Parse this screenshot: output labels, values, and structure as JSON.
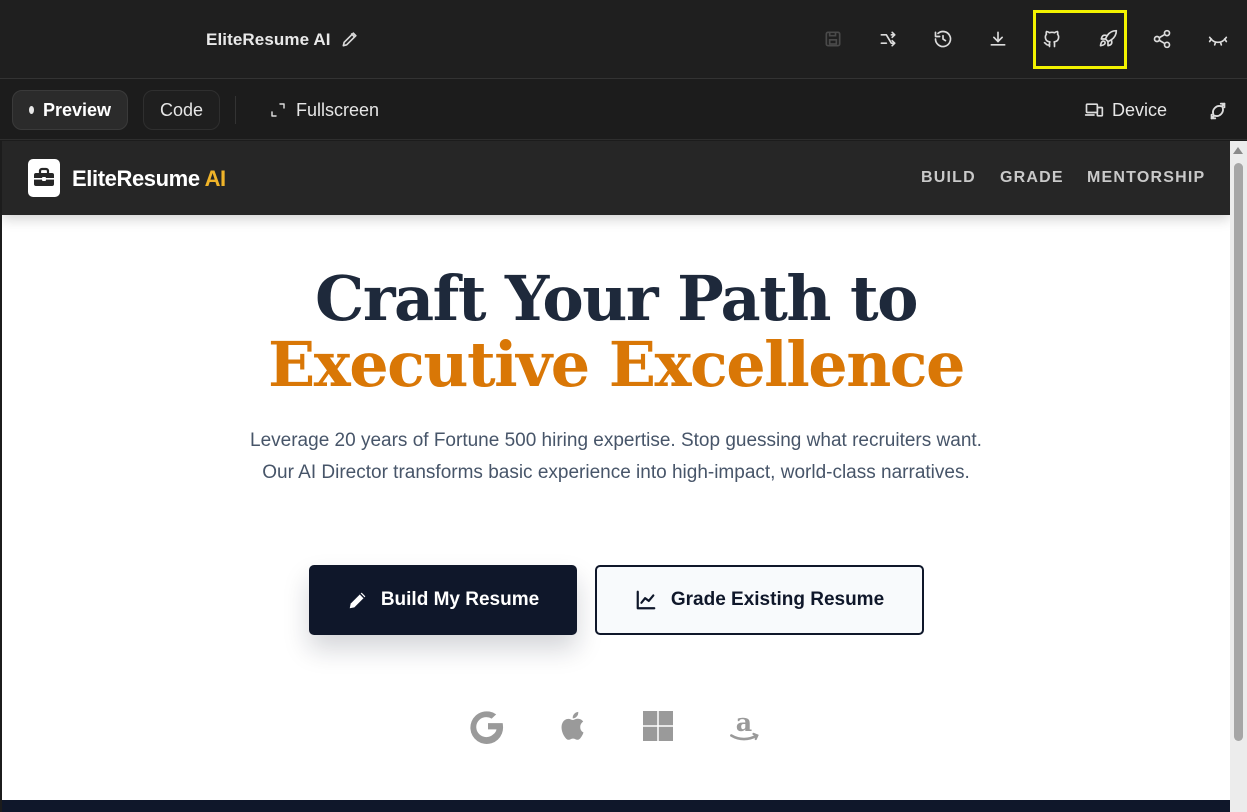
{
  "app": {
    "title": "EliteResume AI"
  },
  "toolbar": {
    "icons": [
      "save-icon",
      "branch-icon",
      "history-icon",
      "download-icon",
      "github-icon",
      "rocket-icon",
      "share-icon",
      "eye-off-icon"
    ],
    "highlight_color": "#f2f200"
  },
  "view_toolbar": {
    "preview_label": "Preview",
    "code_label": "Code",
    "fullscreen_label": "Fullscreen",
    "device_label": "Device"
  },
  "site": {
    "brand_main": "EliteResume",
    "brand_accent": "AI",
    "nav": [
      "BUILD",
      "GRADE",
      "MENTORSHIP"
    ],
    "hero_line1": "Craft Your Path to",
    "hero_line2": "Executive Excellence",
    "hero_sub": "Leverage 20 years of Fortune 500 hiring expertise. Stop guessing what recruiters want. Our AI Director transforms basic experience into high-impact, world-class narratives.",
    "cta_primary": "Build My Resume",
    "cta_secondary": "Grade Existing Resume",
    "company_logos": [
      "google-logo",
      "apple-logo",
      "windows-logo",
      "amazon-logo"
    ],
    "colors": {
      "navy": "#0f172a",
      "heading": "#1e293b",
      "accent_orange": "#d97706",
      "brand_gold": "#f0b429"
    }
  }
}
